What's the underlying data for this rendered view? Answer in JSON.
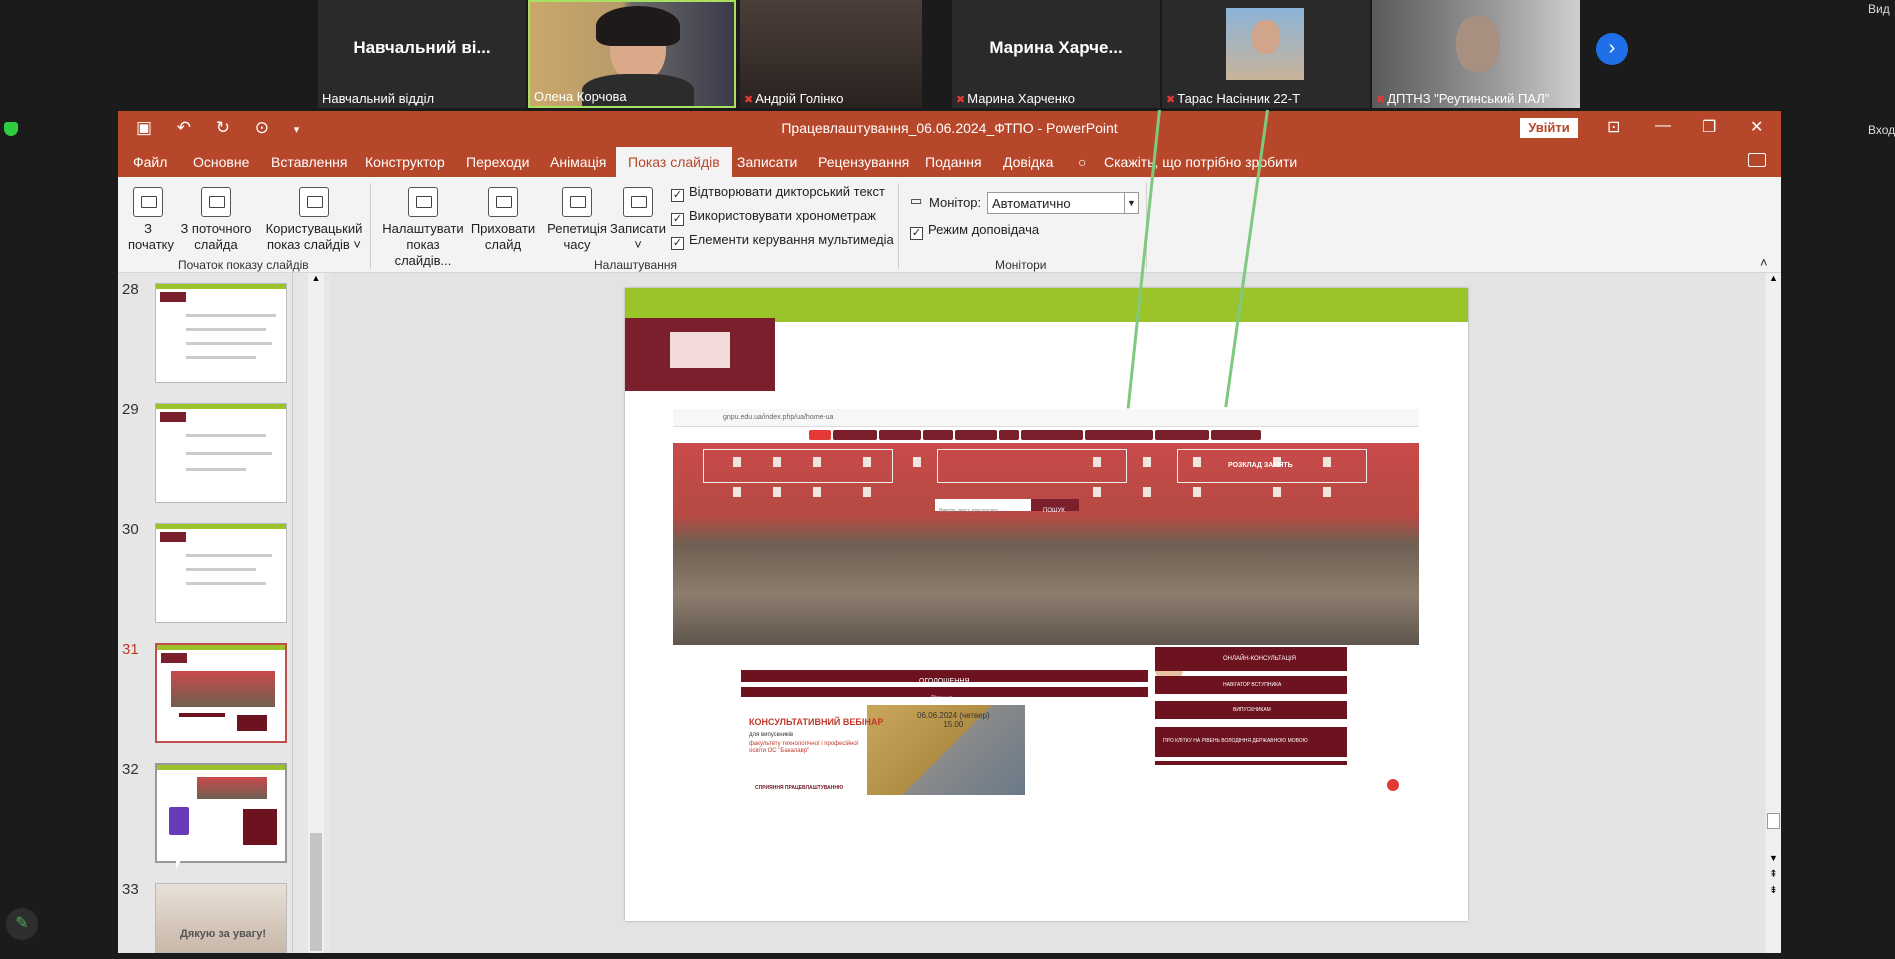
{
  "meeting": {
    "tiles": [
      {
        "big_name": "Навчальний  ві...",
        "caption": "Навчальний відділ",
        "muted": false,
        "video": false
      },
      {
        "big_name": "",
        "caption": "Олена Корчова",
        "muted": false,
        "video": true,
        "active": true
      },
      {
        "big_name": "",
        "caption": "Андрій Голінко",
        "muted": true,
        "video": true
      },
      {
        "big_name": "Марина  Харче...",
        "caption": "Марина Харченко",
        "muted": true,
        "video": false
      },
      {
        "big_name": "",
        "caption": "Тарас Насінник 22-Т",
        "muted": true,
        "video": true
      },
      {
        "big_name": "",
        "caption": "ДПТНЗ \"Реутинський ПАЛ\"",
        "muted": true,
        "video": true
      }
    ],
    "next_icon": "chevron-right-icon",
    "corner_text_right_top": "Вид",
    "corner_text_right_mid": "Вход"
  },
  "ppt": {
    "doc_title": "Працевлаштування_06.06.2024_ФТПО  -  PowerPoint",
    "login_label": "Увійти",
    "menu": [
      "Файл",
      "Основне",
      "Вставлення",
      "Конструктор",
      "Переходи",
      "Анімація",
      "Показ слайдів",
      "Записати",
      "Рецензування",
      "Подання",
      "Довідка"
    ],
    "active_menu": "Показ слайдів",
    "tell_me": "Скажіть, що потрібно зробити",
    "ribbon": {
      "btn_from_start": [
        "З",
        "початку"
      ],
      "btn_from_current": [
        "З поточного",
        "слайда"
      ],
      "btn_custom": [
        "Користувацький",
        "показ слайдів ˅"
      ],
      "group_start": "Початок показу слайдів",
      "btn_setup": [
        "Налаштувати",
        "показ слайдів..."
      ],
      "btn_hide": [
        "Приховати",
        "слайд"
      ],
      "btn_rehearse": [
        "Репетиція",
        "часу"
      ],
      "btn_record": [
        "Записати",
        "˅"
      ],
      "chk_narration": "Відтворювати дикторський текст",
      "chk_timings": "Використовувати хронометраж",
      "chk_media": "Елементи керування мультимедіа",
      "group_setup": "Налаштування",
      "monitor_label": "Монітор:",
      "monitor_value": "Автоматично",
      "chk_presenter": "Режим доповідача",
      "group_monitors": "Монітори"
    },
    "thumbnails": [
      {
        "num": "28",
        "selected": false
      },
      {
        "num": "29",
        "selected": false
      },
      {
        "num": "30",
        "selected": false
      },
      {
        "num": "31",
        "selected": true
      },
      {
        "num": "32",
        "selected": false
      },
      {
        "num": "33",
        "selected": false
      }
    ],
    "slide33_text": "Дякую за увагу!",
    "slide": {
      "browser_url": "gnpu.edu.ua/index.php/ua/home-ua",
      "search_btn": "ПОШУК",
      "search_placeholder": "Введіть текст для пошуку",
      "announce_label": "ОГОЛОШЕННЯ",
      "greeting_label": "Вітання",
      "webinar_title": "КОНСУЛЬТАТИВНИЙ ВЕБІНАР",
      "webinar_sub": "для випускників",
      "webinar_faculty": "факультету технологічної і професійної освіти ОС \"Бакалавр\"",
      "webinar_date": "06.06.2024 (четвер)",
      "webinar_time": "15.00",
      "employment": "СПРИЯННЯ ПРАЦЕВЛАШТУВАННЮ",
      "consult_btn": "ОНЛАЙН-КОНСУЛЬТАЦІЯ",
      "navigator_btn": "НАВІГАТОР ВСТУПНИКА",
      "graduate_btn": "ВИПУСКНИКАМ",
      "language_btn": "ПРО КЛІТКУ НА РІВЕНЬ ВОЛОДІННЯ ДЕРЖАВНОЮ МОВОЮ",
      "hero_right": "РОЗКЛАД ЗАНЯТЬ"
    }
  }
}
